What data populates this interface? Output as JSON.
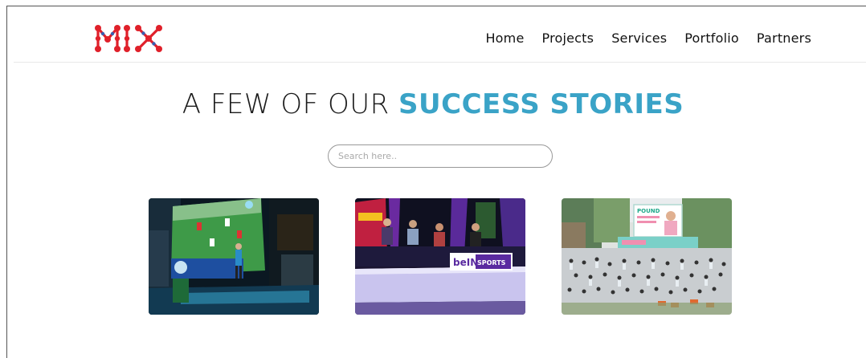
{
  "brand": {
    "logo_text": "MIX",
    "logo_color": "#e0202a"
  },
  "nav": {
    "items": [
      {
        "label": "Home"
      },
      {
        "label": "Projects"
      },
      {
        "label": "Services"
      },
      {
        "label": "Portfolio"
      },
      {
        "label": "Partners"
      }
    ]
  },
  "heading": {
    "light_text": "A FEW OF OUR ",
    "accent_text": "SUCCESS STORIES",
    "accent_color": "#3aa3c7"
  },
  "search": {
    "placeholder": "Search here..",
    "value": ""
  },
  "projects": [
    {
      "icon": "football-screen-event-photo"
    },
    {
      "icon": "bein-sports-panel-event-photo",
      "stage_sign": "beIN SPORTS"
    },
    {
      "icon": "pound-fitness-event-photo",
      "billboard": "POUND"
    }
  ]
}
